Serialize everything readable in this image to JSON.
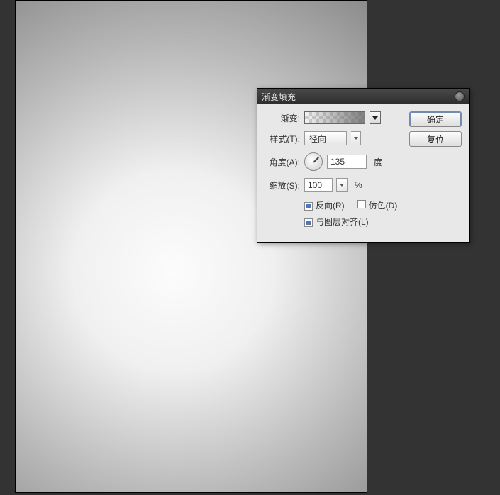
{
  "dialog": {
    "title": "渐变填充",
    "gradient": {
      "label": "渐变:"
    },
    "style": {
      "label": "样式(T):",
      "value": "径向"
    },
    "angle": {
      "label": "角度(A):",
      "value": "135",
      "unit": "度"
    },
    "scale": {
      "label": "缩放(S):",
      "value": "100",
      "unit": "%"
    },
    "reverse": {
      "label": "反向(R)",
      "checked": true
    },
    "dither": {
      "label": "仿色(D)",
      "checked": false
    },
    "align": {
      "label": "与图层对齐(L)",
      "checked": true
    },
    "buttons": {
      "ok": "确定",
      "reset": "复位"
    }
  }
}
